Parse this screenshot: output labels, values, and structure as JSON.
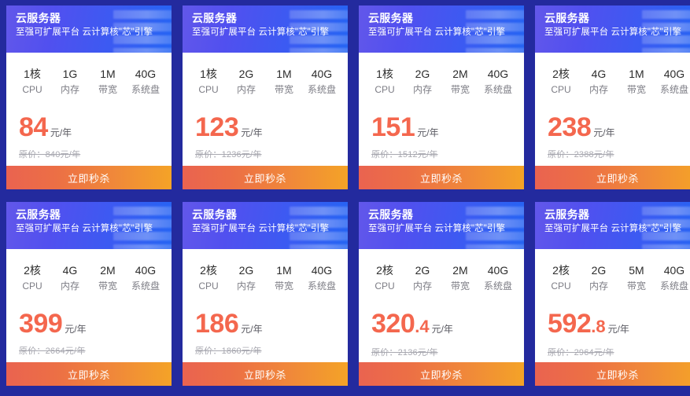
{
  "page": {
    "background_color": "#232a9e",
    "accent_price_color": "#f4674e",
    "header_gradient_from": "#6257ea",
    "header_gradient_to": "#2464f3",
    "button_gradient_from": "#ea6350",
    "button_gradient_to": "#f4a327"
  },
  "common": {
    "title": "云服务器",
    "subtitle": "至强可扩展平台 云计算核\"芯\"引擎",
    "buy_label": "立即秒杀",
    "price_unit": "元/年",
    "spec_labels": [
      "CPU",
      "内存",
      "带宽",
      "系统盘"
    ]
  },
  "cards": [
    {
      "title": "云服务器",
      "subtitle": "至强可扩展平台 云计算核\"芯\"引擎",
      "specs": [
        {
          "value": "1核",
          "label": "CPU"
        },
        {
          "value": "1G",
          "label": "内存"
        },
        {
          "value": "1M",
          "label": "带宽"
        },
        {
          "value": "40G",
          "label": "系统盘"
        }
      ],
      "price": "84",
      "price_decimal": "",
      "price_unit": "元/年",
      "original_price": "原价：840元/年",
      "buy_label": "立即秒杀"
    },
    {
      "title": "云服务器",
      "subtitle": "至强可扩展平台 云计算核\"芯\"引擎",
      "specs": [
        {
          "value": "1核",
          "label": "CPU"
        },
        {
          "value": "2G",
          "label": "内存"
        },
        {
          "value": "1M",
          "label": "带宽"
        },
        {
          "value": "40G",
          "label": "系统盘"
        }
      ],
      "price": "123",
      "price_decimal": "",
      "price_unit": "元/年",
      "original_price": "原价：1236元/年",
      "buy_label": "立即秒杀"
    },
    {
      "title": "云服务器",
      "subtitle": "至强可扩展平台 云计算核\"芯\"引擎",
      "specs": [
        {
          "value": "1核",
          "label": "CPU"
        },
        {
          "value": "2G",
          "label": "内存"
        },
        {
          "value": "2M",
          "label": "带宽"
        },
        {
          "value": "40G",
          "label": "系统盘"
        }
      ],
      "price": "151",
      "price_decimal": "",
      "price_unit": "元/年",
      "original_price": "原价：1512元/年",
      "buy_label": "立即秒杀"
    },
    {
      "title": "云服务器",
      "subtitle": "至强可扩展平台 云计算核\"芯\"引擎",
      "specs": [
        {
          "value": "2核",
          "label": "CPU"
        },
        {
          "value": "4G",
          "label": "内存"
        },
        {
          "value": "1M",
          "label": "带宽"
        },
        {
          "value": "40G",
          "label": "系统盘"
        }
      ],
      "price": "238",
      "price_decimal": "",
      "price_unit": "元/年",
      "original_price": "原价：2388元/年",
      "buy_label": "立即秒杀"
    },
    {
      "title": "云服务器",
      "subtitle": "至强可扩展平台 云计算核\"芯\"引擎",
      "specs": [
        {
          "value": "2核",
          "label": "CPU"
        },
        {
          "value": "4G",
          "label": "内存"
        },
        {
          "value": "2M",
          "label": "带宽"
        },
        {
          "value": "40G",
          "label": "系统盘"
        }
      ],
      "price": "399",
      "price_decimal": "",
      "price_unit": "元/年",
      "original_price": "原价：2664元/年",
      "buy_label": "立即秒杀"
    },
    {
      "title": "云服务器",
      "subtitle": "至强可扩展平台 云计算核\"芯\"引擎",
      "specs": [
        {
          "value": "2核",
          "label": "CPU"
        },
        {
          "value": "2G",
          "label": "内存"
        },
        {
          "value": "1M",
          "label": "带宽"
        },
        {
          "value": "40G",
          "label": "系统盘"
        }
      ],
      "price": "186",
      "price_decimal": "",
      "price_unit": "元/年",
      "original_price": "原价：1860元/年",
      "buy_label": "立即秒杀"
    },
    {
      "title": "云服务器",
      "subtitle": "至强可扩展平台 云计算核\"芯\"引擎",
      "specs": [
        {
          "value": "2核",
          "label": "CPU"
        },
        {
          "value": "2G",
          "label": "内存"
        },
        {
          "value": "2M",
          "label": "带宽"
        },
        {
          "value": "40G",
          "label": "系统盘"
        }
      ],
      "price": "320",
      "price_decimal": ".4",
      "price_unit": "元/年",
      "original_price": "原价：2136元/年",
      "buy_label": "立即秒杀"
    },
    {
      "title": "云服务器",
      "subtitle": "至强可扩展平台 云计算核\"芯\"引擎",
      "specs": [
        {
          "value": "2核",
          "label": "CPU"
        },
        {
          "value": "2G",
          "label": "内存"
        },
        {
          "value": "5M",
          "label": "带宽"
        },
        {
          "value": "40G",
          "label": "系统盘"
        }
      ],
      "price": "592",
      "price_decimal": ".8",
      "price_unit": "元/年",
      "original_price": "原价：2964元/年",
      "buy_label": "立即秒杀"
    }
  ]
}
